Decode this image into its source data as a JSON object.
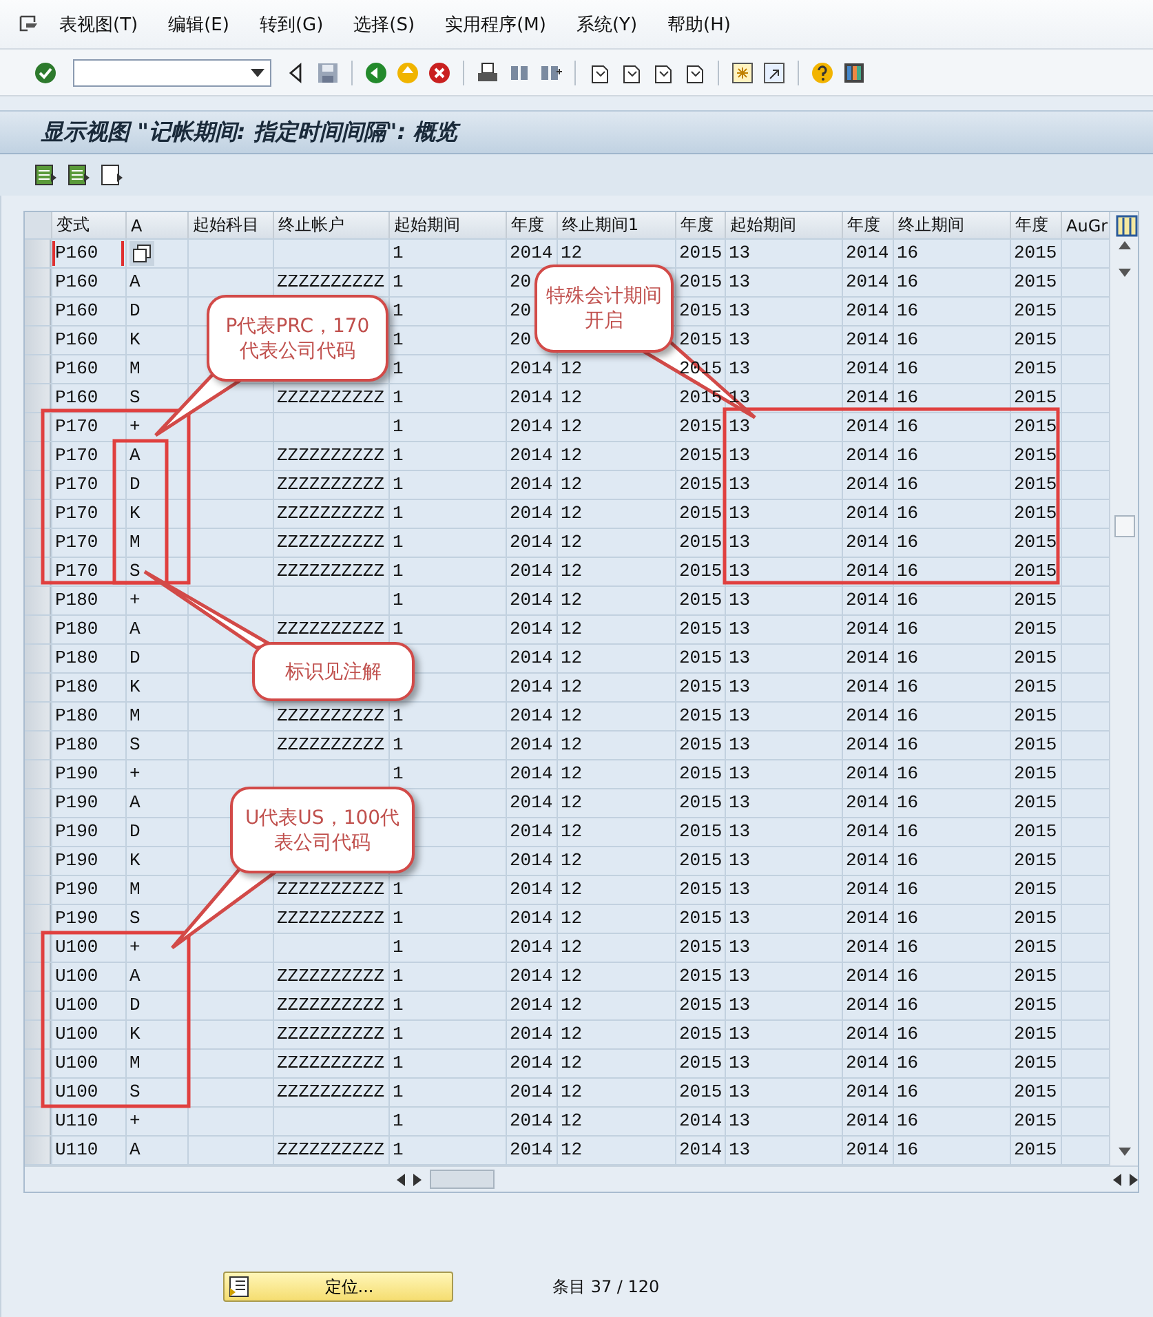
{
  "menu": [
    "表视图(T)",
    "编辑(E)",
    "转到(G)",
    "选择(S)",
    "实用程序(M)",
    "系统(Y)",
    "帮助(H)"
  ],
  "title": "显示视图 \"记帐期间: 指定时间间隔\": 概览",
  "table": {
    "columns": [
      "变式",
      "A",
      "起始科目",
      "终止帐户",
      "起始期间",
      "年度",
      "终止期间1",
      "年度",
      "起始期间",
      "年度",
      "终止期间",
      "年度",
      "AuGr"
    ],
    "rows": [
      {
        "variant": "P160",
        "focused": true,
        "from_period": "1",
        "from_year": "2014",
        "to_period_1": "12",
        "to_year_1": "2015",
        "from_period_2": "13",
        "from_year_2": "2014",
        "to_period_2": "16",
        "to_year_2": "2015"
      },
      {
        "variant": "P160",
        "a": "A",
        "to_account": "ZZZZZZZZZZ",
        "from_period": "1",
        "from_year": "20",
        "to_year_1": "2015",
        "from_period_2": "13",
        "from_year_2": "2014",
        "to_period_2": "16",
        "to_year_2": "2015",
        "focused": false
      },
      {
        "variant": "P160",
        "a": "D",
        "from_period": "1",
        "from_year": "20",
        "to_year_1": "2015",
        "from_period_2": "13",
        "from_year_2": "2014",
        "to_period_2": "16",
        "to_year_2": "2015",
        "focused": false
      },
      {
        "variant": "P160",
        "a": "K",
        "from_period": "1",
        "from_year": "20",
        "to_year_1": "2015",
        "from_period_2": "13",
        "from_year_2": "2014",
        "to_period_2": "16",
        "to_year_2": "2015",
        "focused": false
      },
      {
        "variant": "P160",
        "a": "M",
        "from_period": "1",
        "from_year": "2014",
        "to_period_1": "12",
        "to_year_1": "2015",
        "from_period_2": "13",
        "from_year_2": "2014",
        "to_period_2": "16",
        "to_year_2": "2015",
        "focused": false
      },
      {
        "variant": "P160",
        "a": "S",
        "to_account": "ZZZZZZZZZZ",
        "from_period": "1",
        "from_year": "2014",
        "to_period_1": "12",
        "to_year_1": "2015",
        "from_period_2": "13",
        "from_year_2": "2014",
        "to_period_2": "16",
        "to_year_2": "2015",
        "focused": false
      },
      {
        "variant": "P170",
        "a": "+",
        "from_period": "1",
        "from_year": "2014",
        "to_period_1": "12",
        "to_year_1": "2015",
        "from_period_2": "13",
        "from_year_2": "2014",
        "to_period_2": "16",
        "to_year_2": "2015",
        "focused": false
      },
      {
        "variant": "P170",
        "a": "A",
        "to_account": "ZZZZZZZZZZ",
        "from_period": "1",
        "from_year": "2014",
        "to_period_1": "12",
        "to_year_1": "2015",
        "from_period_2": "13",
        "from_year_2": "2014",
        "to_period_2": "16",
        "to_year_2": "2015",
        "focused": false
      },
      {
        "variant": "P170",
        "a": "D",
        "to_account": "ZZZZZZZZZZ",
        "from_period": "1",
        "from_year": "2014",
        "to_period_1": "12",
        "to_year_1": "2015",
        "from_period_2": "13",
        "from_year_2": "2014",
        "to_period_2": "16",
        "to_year_2": "2015",
        "focused": false
      },
      {
        "variant": "P170",
        "a": "K",
        "to_account": "ZZZZZZZZZZ",
        "from_period": "1",
        "from_year": "2014",
        "to_period_1": "12",
        "to_year_1": "2015",
        "from_period_2": "13",
        "from_year_2": "2014",
        "to_period_2": "16",
        "to_year_2": "2015",
        "focused": false
      },
      {
        "variant": "P170",
        "a": "M",
        "to_account": "ZZZZZZZZZZ",
        "from_period": "1",
        "from_year": "2014",
        "to_period_1": "12",
        "to_year_1": "2015",
        "from_period_2": "13",
        "from_year_2": "2014",
        "to_period_2": "16",
        "to_year_2": "2015",
        "focused": false
      },
      {
        "variant": "P170",
        "a": "S",
        "to_account": "ZZZZZZZZZZ",
        "from_period": "1",
        "from_year": "2014",
        "to_period_1": "12",
        "to_year_1": "2015",
        "from_period_2": "13",
        "from_year_2": "2014",
        "to_period_2": "16",
        "to_year_2": "2015",
        "focused": false
      },
      {
        "variant": "P180",
        "a": "+",
        "from_period": "1",
        "from_year": "2014",
        "to_period_1": "12",
        "to_year_1": "2015",
        "from_period_2": "13",
        "from_year_2": "2014",
        "to_period_2": "16",
        "to_year_2": "2015",
        "focused": false
      },
      {
        "variant": "P180",
        "a": "A",
        "to_account": "ZZZZZZZZZZ",
        "from_period": "1",
        "from_year": "2014",
        "to_period_1": "12",
        "to_year_1": "2015",
        "from_period_2": "13",
        "from_year_2": "2014",
        "to_period_2": "16",
        "to_year_2": "2015",
        "focused": false
      },
      {
        "variant": "P180",
        "a": "D",
        "from_year": "2014",
        "to_period_1": "12",
        "to_year_1": "2015",
        "from_period_2": "13",
        "from_year_2": "2014",
        "to_period_2": "16",
        "to_year_2": "2015",
        "focused": false
      },
      {
        "variant": "P180",
        "a": "K",
        "from_year": "2014",
        "to_period_1": "12",
        "to_year_1": "2015",
        "from_period_2": "13",
        "from_year_2": "2014",
        "to_period_2": "16",
        "to_year_2": "2015",
        "focused": false
      },
      {
        "variant": "P180",
        "a": "M",
        "to_account": "ZZZZZZZZZZ",
        "from_period": "1",
        "from_year": "2014",
        "to_period_1": "12",
        "to_year_1": "2015",
        "from_period_2": "13",
        "from_year_2": "2014",
        "to_period_2": "16",
        "to_year_2": "2015",
        "focused": false
      },
      {
        "variant": "P180",
        "a": "S",
        "to_account": "ZZZZZZZZZZ",
        "from_period": "1",
        "from_year": "2014",
        "to_period_1": "12",
        "to_year_1": "2015",
        "from_period_2": "13",
        "from_year_2": "2014",
        "to_period_2": "16",
        "to_year_2": "2015",
        "focused": false
      },
      {
        "variant": "P190",
        "a": "+",
        "from_period": "1",
        "from_year": "2014",
        "to_period_1": "12",
        "to_year_1": "2015",
        "from_period_2": "13",
        "from_year_2": "2014",
        "to_period_2": "16",
        "to_year_2": "2015",
        "focused": false
      },
      {
        "variant": "P190",
        "a": "A",
        "from_year": "2014",
        "to_period_1": "12",
        "to_year_1": "2015",
        "from_period_2": "13",
        "from_year_2": "2014",
        "to_period_2": "16",
        "to_year_2": "2015",
        "focused": false
      },
      {
        "variant": "P190",
        "a": "D",
        "from_year": "2014",
        "to_period_1": "12",
        "to_year_1": "2015",
        "from_period_2": "13",
        "from_year_2": "2014",
        "to_period_2": "16",
        "to_year_2": "2015",
        "focused": false
      },
      {
        "variant": "P190",
        "a": "K",
        "from_year": "2014",
        "to_period_1": "12",
        "to_year_1": "2015",
        "from_period_2": "13",
        "from_year_2": "2014",
        "to_period_2": "16",
        "to_year_2": "2015",
        "focused": false
      },
      {
        "variant": "P190",
        "a": "M",
        "to_account": "ZZZZZZZZZZ",
        "from_period": "1",
        "from_year": "2014",
        "to_period_1": "12",
        "to_year_1": "2015",
        "from_period_2": "13",
        "from_year_2": "2014",
        "to_period_2": "16",
        "to_year_2": "2015",
        "focused": false
      },
      {
        "variant": "P190",
        "a": "S",
        "to_account": "ZZZZZZZZZZ",
        "from_period": "1",
        "from_year": "2014",
        "to_period_1": "12",
        "to_year_1": "2015",
        "from_period_2": "13",
        "from_year_2": "2014",
        "to_period_2": "16",
        "to_year_2": "2015",
        "focused": false
      },
      {
        "variant": "U100",
        "a": "+",
        "from_period": "1",
        "from_year": "2014",
        "to_period_1": "12",
        "to_year_1": "2015",
        "from_period_2": "13",
        "from_year_2": "2014",
        "to_period_2": "16",
        "to_year_2": "2015",
        "focused": false
      },
      {
        "variant": "U100",
        "a": "A",
        "to_account": "ZZZZZZZZZZ",
        "from_period": "1",
        "from_year": "2014",
        "to_period_1": "12",
        "to_year_1": "2015",
        "from_period_2": "13",
        "from_year_2": "2014",
        "to_period_2": "16",
        "to_year_2": "2015",
        "focused": false
      },
      {
        "variant": "U100",
        "a": "D",
        "to_account": "ZZZZZZZZZZ",
        "from_period": "1",
        "from_year": "2014",
        "to_period_1": "12",
        "to_year_1": "2015",
        "from_period_2": "13",
        "from_year_2": "2014",
        "to_period_2": "16",
        "to_year_2": "2015",
        "focused": false
      },
      {
        "variant": "U100",
        "a": "K",
        "to_account": "ZZZZZZZZZZ",
        "from_period": "1",
        "from_year": "2014",
        "to_period_1": "12",
        "to_year_1": "2015",
        "from_period_2": "13",
        "from_year_2": "2014",
        "to_period_2": "16",
        "to_year_2": "2015",
        "focused": false
      },
      {
        "variant": "U100",
        "a": "M",
        "to_account": "ZZZZZZZZZZ",
        "from_period": "1",
        "from_year": "2014",
        "to_period_1": "12",
        "to_year_1": "2015",
        "from_period_2": "13",
        "from_year_2": "2014",
        "to_period_2": "16",
        "to_year_2": "2015",
        "focused": false
      },
      {
        "variant": "U100",
        "a": "S",
        "to_account": "ZZZZZZZZZZ",
        "from_period": "1",
        "from_year": "2014",
        "to_period_1": "12",
        "to_year_1": "2015",
        "from_period_2": "13",
        "from_year_2": "2014",
        "to_period_2": "16",
        "to_year_2": "2015",
        "focused": false
      },
      {
        "variant": "U110",
        "a": "+",
        "from_period": "1",
        "from_year": "2014",
        "to_period_1": "12",
        "to_year_1": "2014",
        "from_period_2": "13",
        "from_year_2": "2014",
        "to_period_2": "16",
        "to_year_2": "2015",
        "focused": false
      },
      {
        "variant": "U110",
        "a": "A",
        "to_account": "ZZZZZZZZZZ",
        "from_period": "1",
        "from_year": "2014",
        "to_period_1": "12",
        "to_year_1": "2014",
        "from_period_2": "13",
        "from_year_2": "2014",
        "to_period_2": "16",
        "to_year_2": "2015",
        "focused": false
      }
    ]
  },
  "position_button": "定位...",
  "entry_count": "条目 37 / 120",
  "annotations": [
    {
      "text": "P代表PRC，170代表公司代码"
    },
    {
      "text": "特殊会计期间开启"
    },
    {
      "text": "标识见注解"
    },
    {
      "text": "U代表US，100代表公司代码"
    }
  ]
}
